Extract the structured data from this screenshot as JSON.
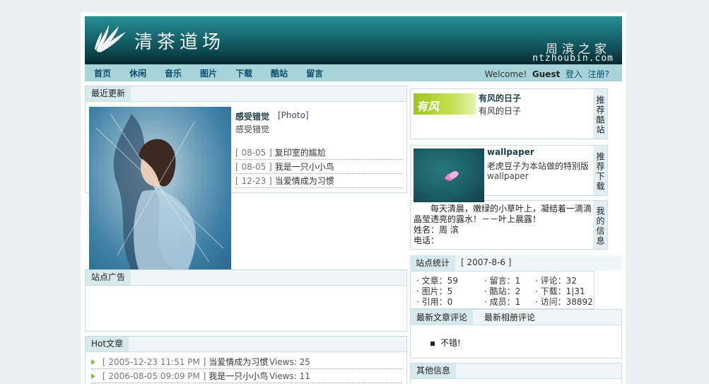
{
  "site": {
    "title": "清茶道场",
    "owner": "周滨之家",
    "domain": "ntzhoubin.com"
  },
  "nav": [
    "首页",
    "休闲",
    "音乐",
    "图片",
    "下载",
    "酷站",
    "留言"
  ],
  "user": {
    "welcome": "Welcome!",
    "name": "Guest",
    "login": "登入",
    "register": "注册?"
  },
  "recent": {
    "tab": "最近更新",
    "featured_title": "感受错觉",
    "featured_tag": "[Photo]",
    "featured_sub": "感受错觉",
    "items": [
      {
        "date": "[ 08-05 ]",
        "title": "复印室的尴尬"
      },
      {
        "date": "[ 08-05 ]",
        "title": "我是一只小小鸟"
      },
      {
        "date": "[ 12-23 ]",
        "title": "当爱情成为习惯"
      }
    ]
  },
  "ad": {
    "tab": "站点广告"
  },
  "hot": {
    "tab": "Hot文章",
    "items": [
      {
        "date": "[ 2005-12-23 11:51 PM ]",
        "title": "当爱情成为习惯",
        "views": "Views: 25"
      },
      {
        "date": "[ 2006-08-05 09:09 PM ]",
        "title": "我是一只小小鸟",
        "views": "Views: 11"
      }
    ]
  },
  "cool": {
    "side": "推荐酷站",
    "img_text": "有风",
    "name": "有风的日子",
    "desc": "有风的日子"
  },
  "download": {
    "side": "推荐下载",
    "name": "wallpaper",
    "desc": "老虎豆子为本站做的特别版",
    "sub": "wallpaper"
  },
  "info": {
    "side": "我的信息",
    "text": "每天清晨，嫩绿的小草叶上，凝结着一滴滴晶莹透亮的露水！－－叶上晨露！",
    "name_line": "姓名：周 滨",
    "phone_line": "电话："
  },
  "stats": {
    "tab": "站点统计",
    "date": "[ 2007-8-6 ]",
    "cells": [
      "· 文章：59",
      "· 留言：1",
      "· 评论：32",
      "· 图片：5",
      "· 酷站：2",
      "· 下载：1|31",
      "· 引用：0",
      "· 成员：1",
      "· 访问：38892"
    ]
  },
  "comments": {
    "tab_article": "最新文章评论",
    "tab_album": "最新相册评论",
    "item": "不错!"
  },
  "other": {
    "tab": "其他信息"
  },
  "colors": {
    "banner": "#0e4d54",
    "nav": "#a7d4d9",
    "tab": "#d6e9ed",
    "accent": "#0e4e6d"
  }
}
